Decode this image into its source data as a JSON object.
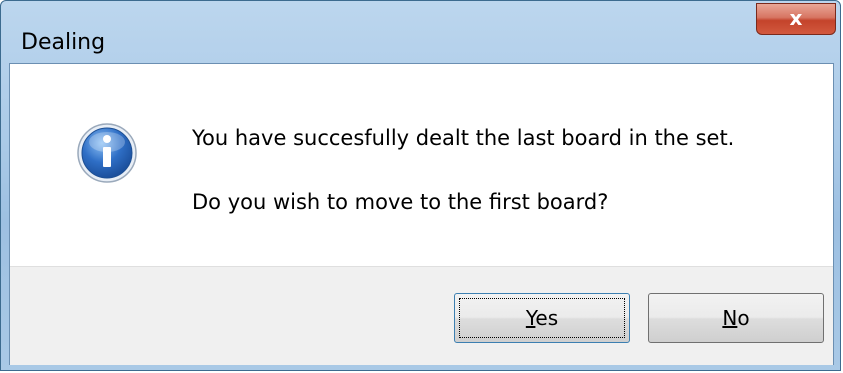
{
  "window": {
    "title": "Dealing",
    "close_glyph": "x"
  },
  "message": {
    "line1": "You have succesfully dealt the last board in the set.",
    "line2": "Do you wish to move to the first board?",
    "icon": "information-icon"
  },
  "buttons": {
    "yes": {
      "accel": "Y",
      "rest": "es"
    },
    "no": {
      "accel": "N",
      "rest": "o"
    }
  },
  "colors": {
    "title_bar": "#a9c9e7",
    "close_button": "#c4432b",
    "info_icon": "#2f6fc6",
    "footer": "#f0f0f0"
  }
}
